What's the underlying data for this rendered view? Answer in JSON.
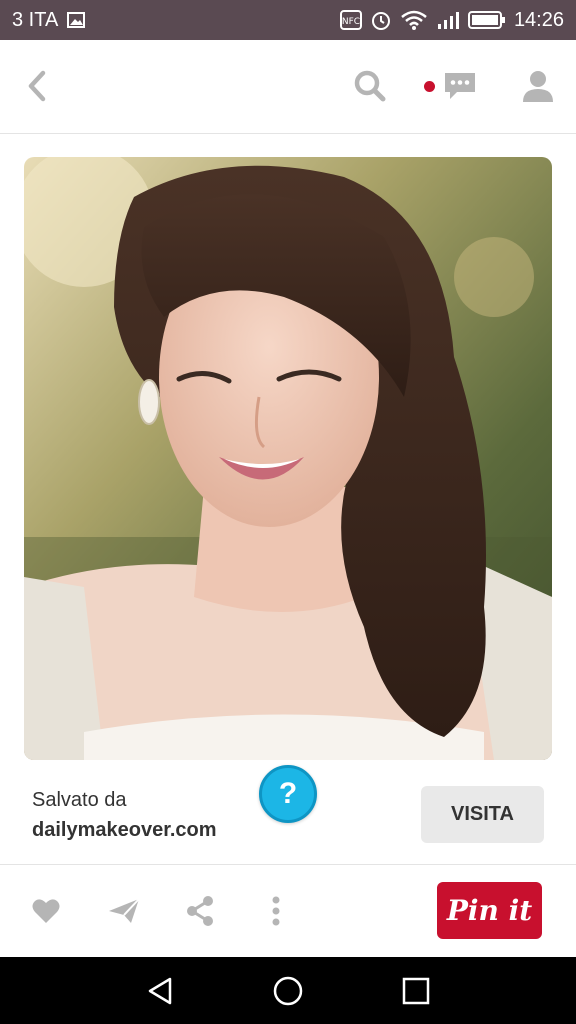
{
  "status_bar": {
    "carrier": "3 ITA",
    "nfc": "NFC",
    "time": "14:26",
    "icons": [
      "image-icon",
      "nfc-icon",
      "alarm-icon",
      "wifi-icon",
      "signal-icon",
      "battery-icon"
    ]
  },
  "top_bar": {
    "icons": [
      "back-arrow-icon",
      "search-icon",
      "notification-dot-icon",
      "messages-icon",
      "profile-icon"
    ]
  },
  "pin": {
    "image_description_icon": "photo-image",
    "saved_label": "Salvato da",
    "source": "dailymakeover.com",
    "visit_label": "VISITA",
    "help_label": "?"
  },
  "actions": {
    "icons": [
      "heart-icon",
      "send-icon",
      "share-icon",
      "more-icon"
    ],
    "pinit_label": "Pin it"
  },
  "nav_bar": {
    "icons": [
      "nav-back-icon",
      "nav-home-icon",
      "nav-recents-icon"
    ]
  },
  "colors": {
    "status_bar": "#5a4a52",
    "brand_red": "#c8102e",
    "help_blue": "#1cb6e6",
    "icon_gray": "#b5b5b5"
  }
}
